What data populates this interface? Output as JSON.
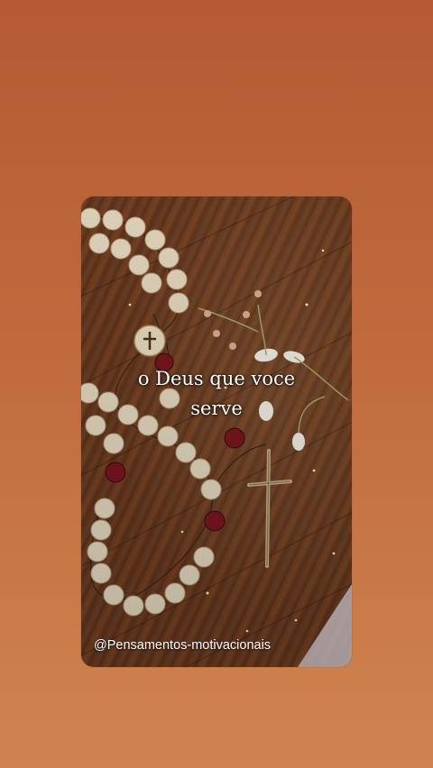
{
  "story": {
    "caption_line1": "o Deus que voce",
    "caption_line2": "serve",
    "handle": "@Pensamentos-motivacionais"
  },
  "image": {
    "subject_icon": "rosary-icon",
    "colors": {
      "background_top": "#b55a33",
      "background_bottom": "#cf844f",
      "wood": "#6a391d",
      "beads": "#e9dcc3",
      "red_beads": "#7a1620"
    }
  }
}
